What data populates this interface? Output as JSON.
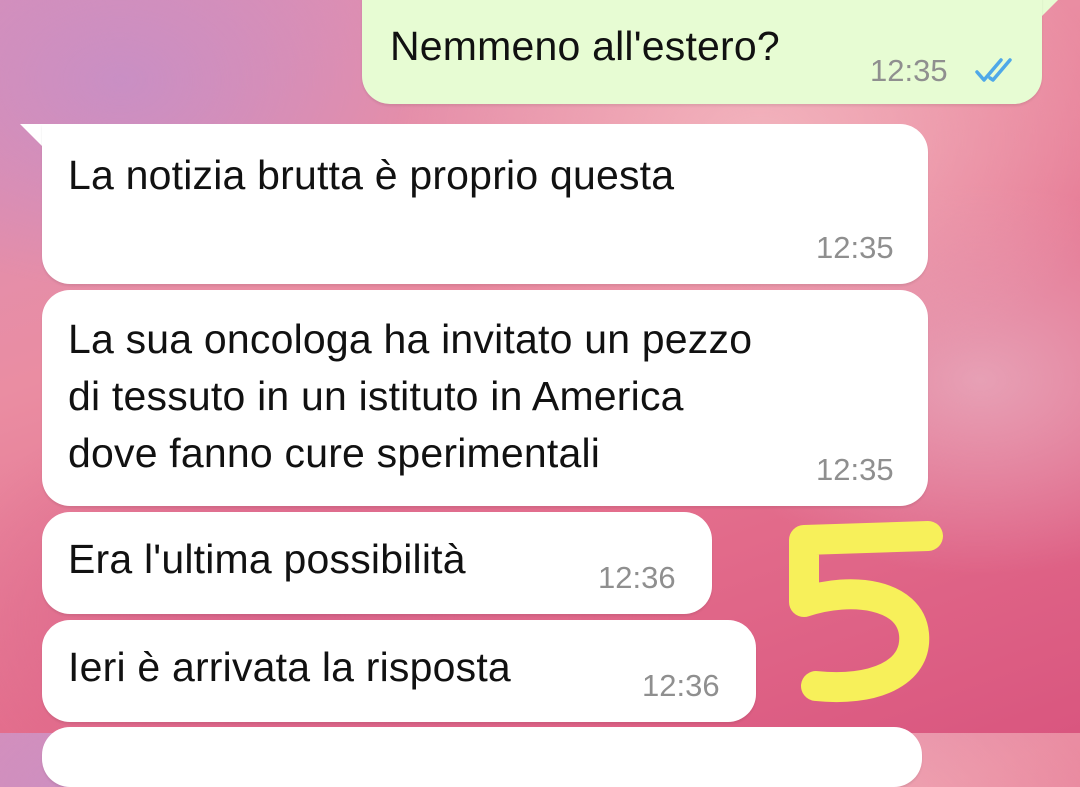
{
  "messages": [
    {
      "direction": "outgoing",
      "text": "Nemmeno all'estero?",
      "time": "12:35",
      "status_icon": "double-check-read-icon"
    },
    {
      "direction": "incoming",
      "text": "La notizia brutta è proprio questa",
      "time": "12:35"
    },
    {
      "direction": "incoming",
      "lines": [
        "La sua oncologa ha invitato un pezzo",
        "di tessuto in un istituto in America",
        "dove fanno cure sperimentali"
      ],
      "time": "12:35"
    },
    {
      "direction": "incoming",
      "text": "Era l'ultima possibilità",
      "time": "12:36"
    },
    {
      "direction": "incoming",
      "text": "Ieri è arrivata la risposta",
      "time": "12:36"
    }
  ],
  "annotation": {
    "text": "5",
    "color": "#f7f05a"
  },
  "colors": {
    "outgoing_bubble": "#e7fcd3",
    "incoming_bubble": "#ffffff",
    "read_ticks": "#4fa8e8"
  }
}
